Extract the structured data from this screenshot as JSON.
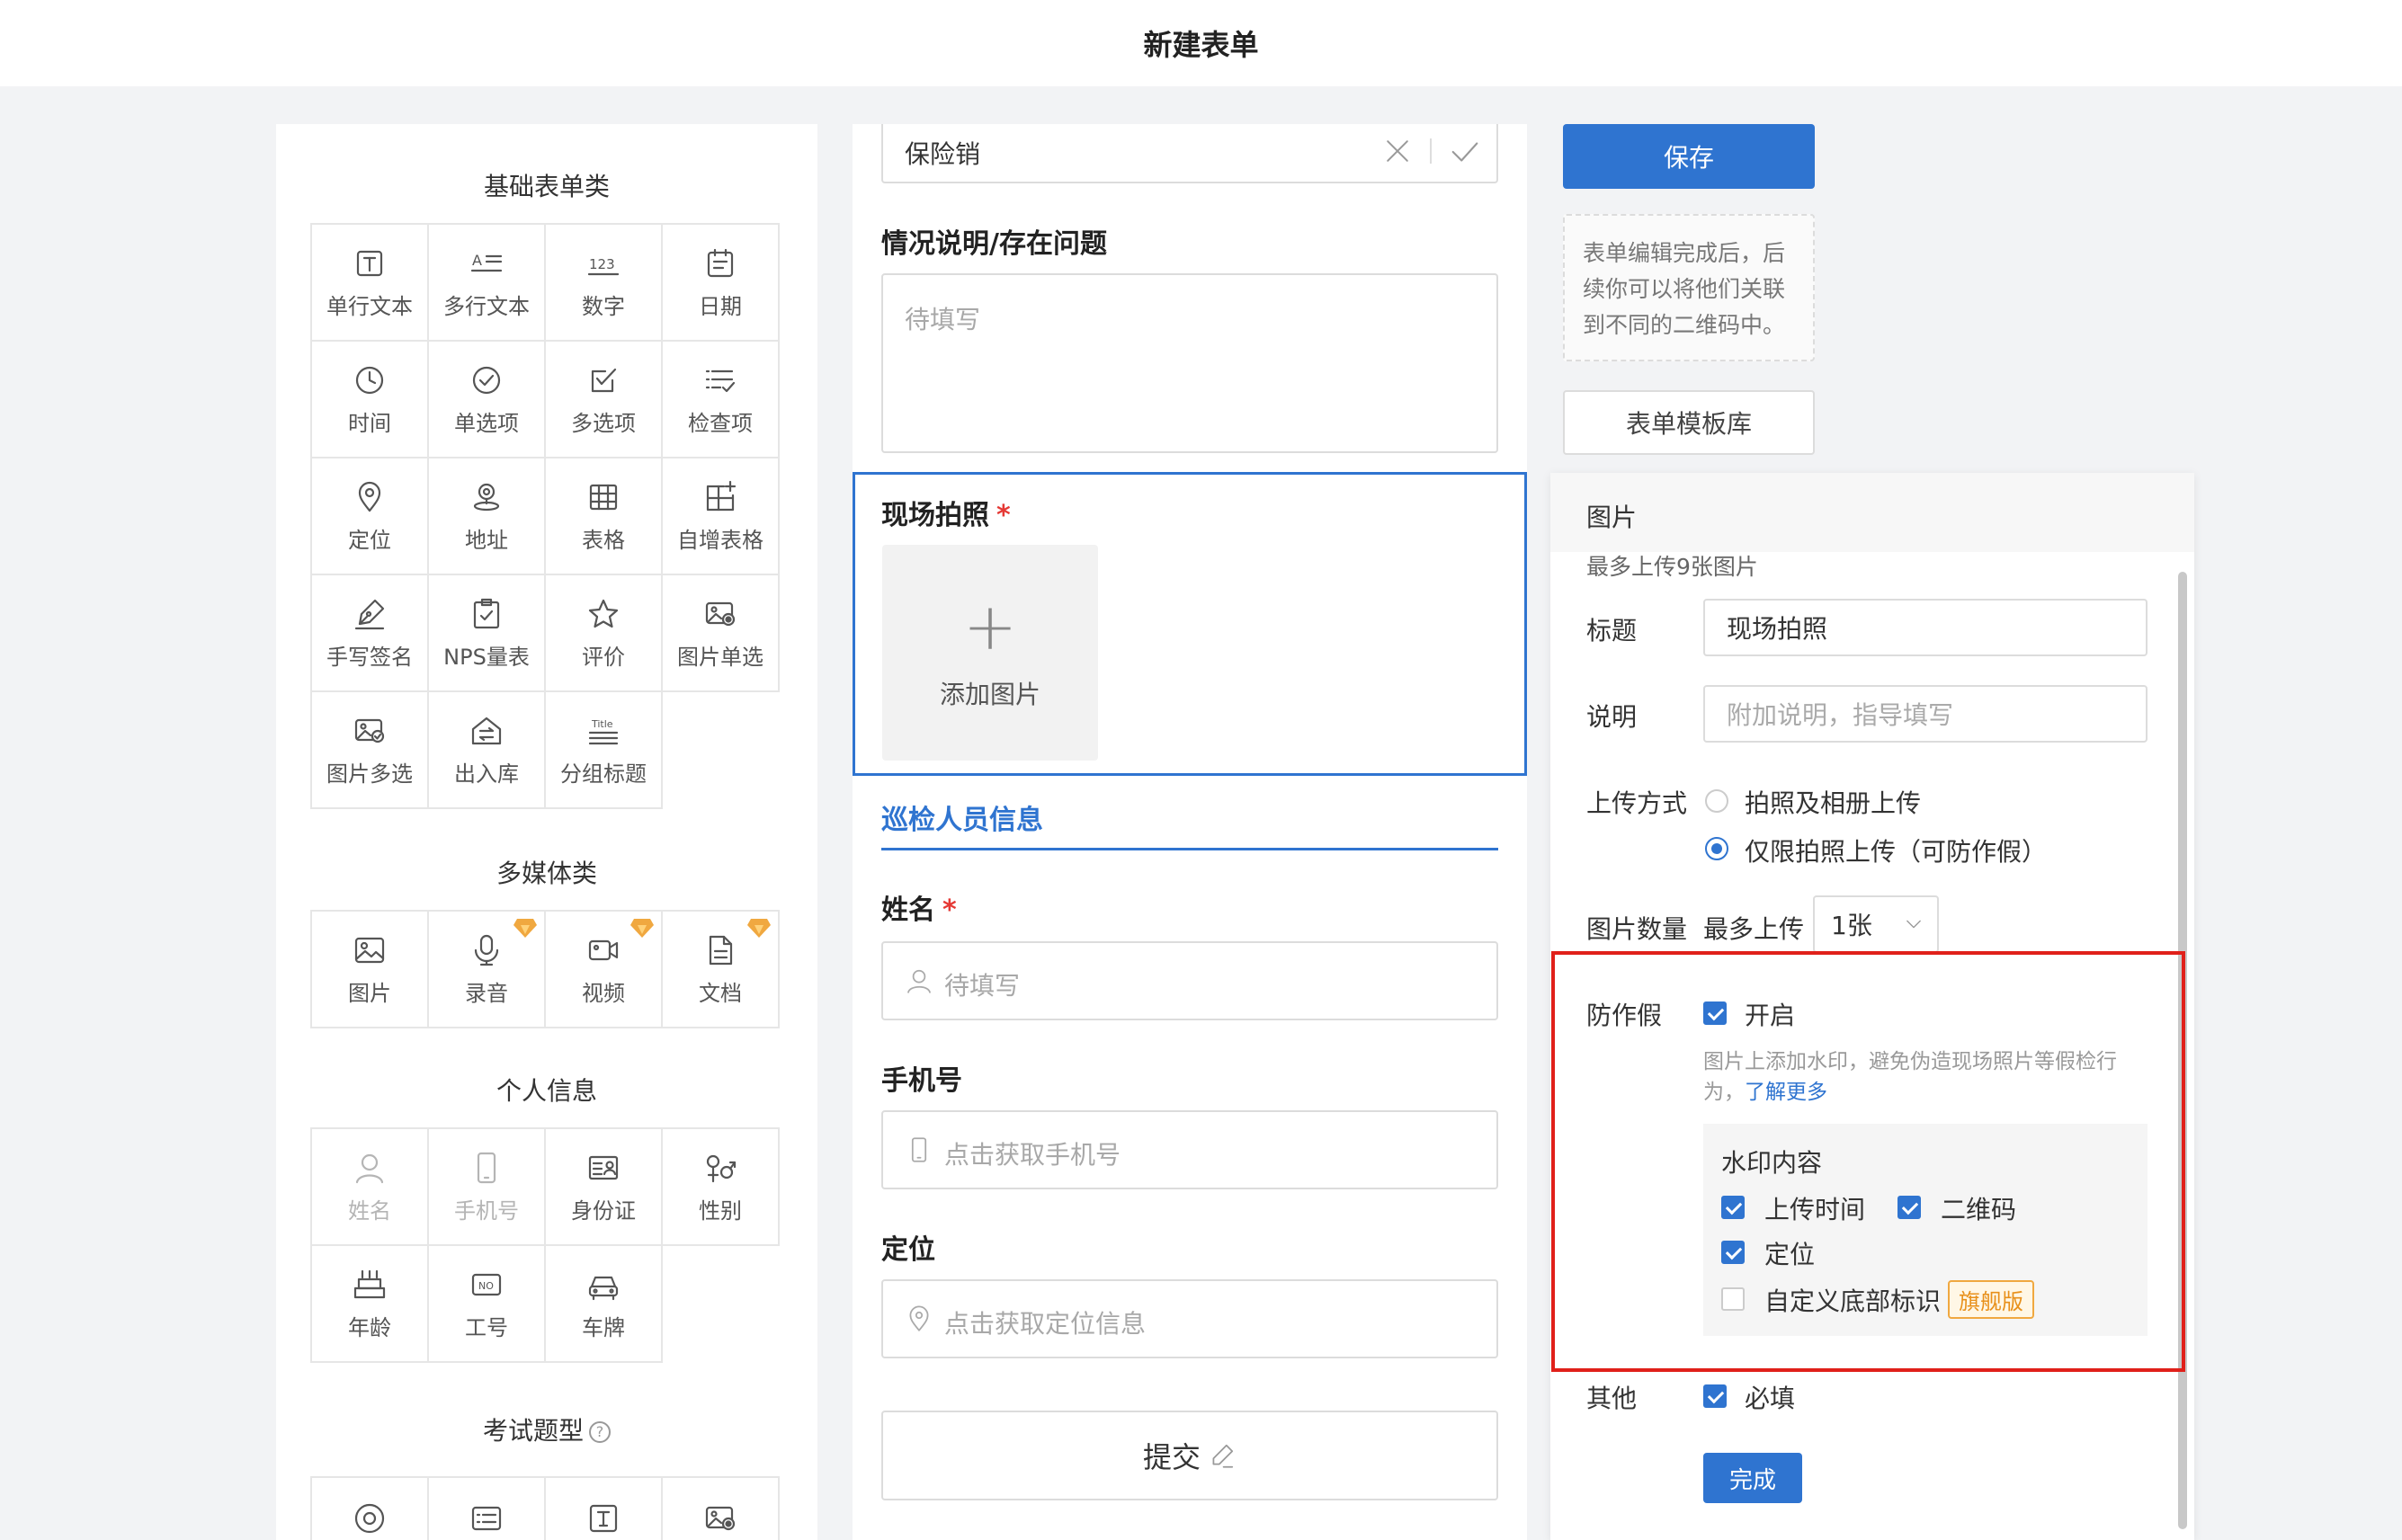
{
  "header": {
    "title": "新建表单"
  },
  "left": {
    "basic_title": "基础表单类",
    "basic_items": [
      {
        "label": "单行文本",
        "icon": "single-line-text-icon"
      },
      {
        "label": "多行文本",
        "icon": "multi-line-text-icon"
      },
      {
        "label": "数字",
        "icon": "number-icon"
      },
      {
        "label": "日期",
        "icon": "date-icon"
      },
      {
        "label": "时间",
        "icon": "clock-icon"
      },
      {
        "label": "单选项",
        "icon": "radio-icon"
      },
      {
        "label": "多选项",
        "icon": "checkbox-icon"
      },
      {
        "label": "检查项",
        "icon": "checklist-icon"
      },
      {
        "label": "定位",
        "icon": "location-pin-icon"
      },
      {
        "label": "地址",
        "icon": "address-icon"
      },
      {
        "label": "表格",
        "icon": "table-icon"
      },
      {
        "label": "自增表格",
        "icon": "table-add-icon"
      },
      {
        "label": "手写签名",
        "icon": "pen-icon"
      },
      {
        "label": "NPS量表",
        "icon": "nps-icon"
      },
      {
        "label": "评价",
        "icon": "star-icon"
      },
      {
        "label": "图片单选",
        "icon": "image-radio-icon"
      },
      {
        "label": "图片多选",
        "icon": "image-checkbox-icon"
      },
      {
        "label": "出入库",
        "icon": "warehouse-icon"
      },
      {
        "label": "分组标题",
        "icon": "group-title-icon",
        "icon_text": "Title"
      }
    ],
    "media_title": "多媒体类",
    "media_items": [
      {
        "label": "图片",
        "icon": "image-icon",
        "premium": false
      },
      {
        "label": "录音",
        "icon": "microphone-icon",
        "premium": true
      },
      {
        "label": "视频",
        "icon": "video-icon",
        "premium": true
      },
      {
        "label": "文档",
        "icon": "document-icon",
        "premium": true
      }
    ],
    "personal_title": "个人信息",
    "personal_items": [
      {
        "label": "姓名",
        "icon": "person-icon",
        "disabled": true
      },
      {
        "label": "手机号",
        "icon": "phone-icon",
        "disabled": true
      },
      {
        "label": "身份证",
        "icon": "id-card-icon",
        "disabled": false
      },
      {
        "label": "性别",
        "icon": "gender-icon",
        "disabled": false
      },
      {
        "label": "年龄",
        "icon": "cake-icon",
        "disabled": false
      },
      {
        "label": "工号",
        "icon": "badge-no-icon",
        "icon_text": "NO",
        "disabled": false
      },
      {
        "label": "车牌",
        "icon": "car-icon",
        "disabled": false
      }
    ],
    "exam_title": "考试题型"
  },
  "form": {
    "top_input_value": "保险销",
    "situation_label": "情况说明/存在问题",
    "situation_placeholder": "待填写",
    "photo_label": "现场拍照",
    "required_mark": "*",
    "add_photo_label": "添加图片",
    "group_title": "巡检人员信息",
    "name_label": "姓名",
    "name_placeholder": "待填写",
    "phone_label": "手机号",
    "phone_placeholder": "点击获取手机号",
    "location_label": "定位",
    "location_placeholder": "点击获取定位信息",
    "submit_label": "提交"
  },
  "right": {
    "save_label": "保存",
    "tip_text": "表单编辑完成后，后续你可以将他们关联到不同的二维码中。",
    "template_label": "表单模板库"
  },
  "props": {
    "header": "图片",
    "limit_note": "最多上传9张图片",
    "title_label": "标题",
    "title_value": "现场拍照",
    "desc_label": "说明",
    "desc_placeholder": "附加说明，指导填写",
    "upload_label": "上传方式",
    "upload_options": [
      {
        "label": "拍照及相册上传",
        "selected": false
      },
      {
        "label": "仅限拍照上传（可防作假）",
        "selected": true
      }
    ],
    "count_label": "图片数量",
    "count_prefix": "最多上传",
    "count_value": "1张",
    "anti_fake_label": "防作假",
    "anti_fake_enabled_label": "开启",
    "anti_fake_enabled": true,
    "anti_fake_desc": "图片上添加水印，避免伪造现场照片等假检行为，",
    "learn_more": "了解更多",
    "watermark_title": "水印内容",
    "watermark_items": [
      {
        "label": "上传时间",
        "checked": true
      },
      {
        "label": "二维码",
        "checked": true
      },
      {
        "label": "定位",
        "checked": true
      },
      {
        "label": "自定义底部标识",
        "checked": false
      }
    ],
    "pro_tag": "旗舰版",
    "other_label": "其他",
    "required_label": "必填",
    "required_checked": true,
    "done_label": "完成"
  },
  "colors": {
    "accent": "#2f74d0",
    "highlight_frame": "#e0201a",
    "premium": "#f0a840"
  }
}
